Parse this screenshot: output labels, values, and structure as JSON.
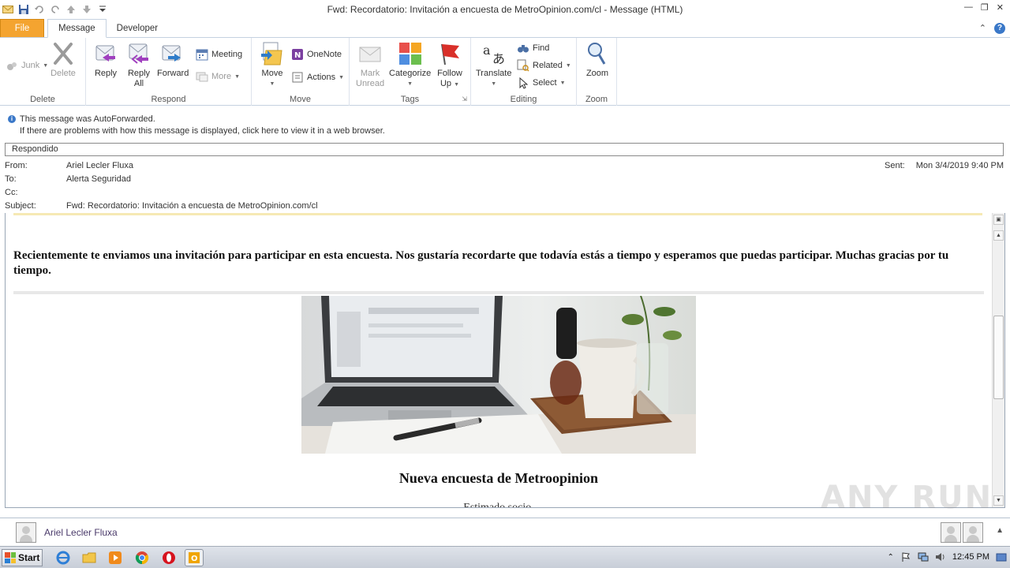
{
  "window": {
    "title": "Fwd: Recordatorio: Invitación a encuesta de MetroOpinion.com/cl  -  Message (HTML)"
  },
  "tabs": [
    {
      "label": "File"
    },
    {
      "label": "Message"
    },
    {
      "label": "Developer"
    }
  ],
  "ribbon": {
    "delete": {
      "label": "Delete",
      "junk": "Junk",
      "delete": "Delete"
    },
    "respond": {
      "label": "Respond",
      "reply": "Reply",
      "reply_all_1": "Reply",
      "reply_all_2": "All",
      "forward": "Forward",
      "meeting": "Meeting",
      "more": "More"
    },
    "move": {
      "label": "Move",
      "move": "Move",
      "onenote": "OneNote",
      "actions": "Actions"
    },
    "tags": {
      "label": "Tags",
      "mark_unread_1": "Mark",
      "mark_unread_2": "Unread",
      "categorize": "Categorize",
      "follow_up_1": "Follow",
      "follow_up_2": "Up"
    },
    "editing": {
      "label": "Editing",
      "translate": "Translate",
      "find": "Find",
      "related": "Related",
      "select": "Select"
    },
    "zoom": {
      "label": "Zoom",
      "zoom": "Zoom"
    }
  },
  "info": {
    "line1": "This message was AutoForwarded.",
    "line2": "If there are problems with how this message is displayed, click here to view it in a web browser."
  },
  "flag_text": "Respondido",
  "headers": {
    "from_label": "From:",
    "from": "Ariel Lecler Fluxa",
    "to_label": "To:",
    "to": "Alerta Seguridad",
    "cc_label": "Cc:",
    "cc": "",
    "subject_label": "Subject:",
    "subject": "Fwd: Recordatorio: Invitación a encuesta de MetroOpinion.com/cl",
    "sent_label": "Sent:",
    "sent": "Mon 3/4/2019 9:40 PM"
  },
  "body": {
    "paragraph": "Recientemente te enviamos una invitación para participar en esta encuesta. Nos gustaría recordarte que todavía estás a tiempo y esperamos que puedas participar. Muchas gracias por tu tiempo.",
    "heading": "Nueva encuesta de Metroopinion",
    "greeting": "Estimado socio,"
  },
  "people_pane": {
    "name": "Ariel Lecler Fluxa"
  },
  "watermark": "ANY RUN",
  "taskbar": {
    "start": "Start",
    "clock": "12:45 PM"
  }
}
